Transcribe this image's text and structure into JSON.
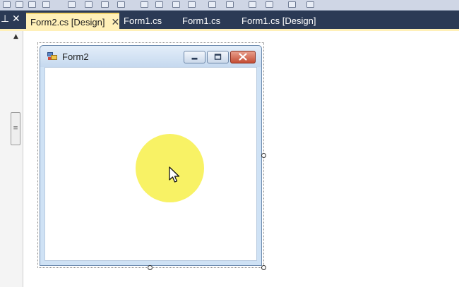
{
  "editor": {
    "tabs": [
      {
        "label": "Form2.cs [Design]",
        "active": true,
        "close_glyph": "✕"
      },
      {
        "label": "Form1.cs",
        "active": false
      },
      {
        "label": "Form1.cs",
        "active": false
      },
      {
        "label": "Form1.cs [Design]",
        "active": false
      }
    ],
    "panel_controls": {
      "pin_glyph": "⊥",
      "close_glyph": "✕"
    }
  },
  "designer": {
    "form": {
      "title": "Form2",
      "icon": "form-window-icon",
      "caption_buttons": [
        "minimize-icon",
        "maximize-icon",
        "close-icon"
      ]
    }
  },
  "overlay": {
    "click_highlight_color": "#f7f050",
    "cursor": "arrow-cursor-icon"
  },
  "colors": {
    "tab_strip": "#2b3a55",
    "active_tab": "#fff0b8",
    "form_border": "#6f8db0",
    "close_button": "#c44d34"
  }
}
